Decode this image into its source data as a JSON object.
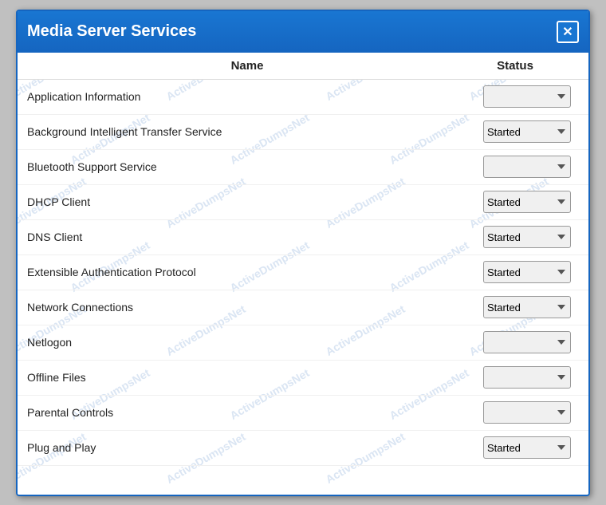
{
  "window": {
    "title": "Media Server Services",
    "close_label": "✕"
  },
  "table": {
    "col_name": "Name",
    "col_status": "Status"
  },
  "services": [
    {
      "name": "Application Information",
      "status": "",
      "started": false
    },
    {
      "name": "Background Intelligent Transfer Service",
      "status": "Started",
      "started": true
    },
    {
      "name": "Bluetooth Support Service",
      "status": "",
      "started": false
    },
    {
      "name": "DHCP Client",
      "status": "Started",
      "started": true
    },
    {
      "name": "DNS Client",
      "status": "Started",
      "started": true
    },
    {
      "name": "Extensible Authentication Protocol",
      "status": "Started",
      "started": true
    },
    {
      "name": "Network Connections",
      "status": "Started",
      "started": true
    },
    {
      "name": "Netlogon",
      "status": "",
      "started": false
    },
    {
      "name": "Offline Files",
      "status": "",
      "started": false
    },
    {
      "name": "Parental Controls",
      "status": "",
      "started": false
    },
    {
      "name": "Plug and Play",
      "status": "Started",
      "started": true
    }
  ],
  "watermarks": [
    "ActiveDumpsNet",
    "ActiveDumpsNet",
    "ActiveDumpsNet",
    "ActiveDumpsNet",
    "ActiveDumpsNet",
    "ActiveDumpsNet",
    "ActiveDumpsNet",
    "ActiveDumpsNet",
    "ActiveDumpsNet",
    "ActiveDumpsNet",
    "ActiveDumpsNet",
    "ActiveDumpsNet",
    "ActiveDumpsNet",
    "ActiveDumpsNet",
    "ActiveDumpsNet",
    "ActiveDumpsNet",
    "ActiveDumpsNet",
    "ActiveDumpsNet"
  ]
}
